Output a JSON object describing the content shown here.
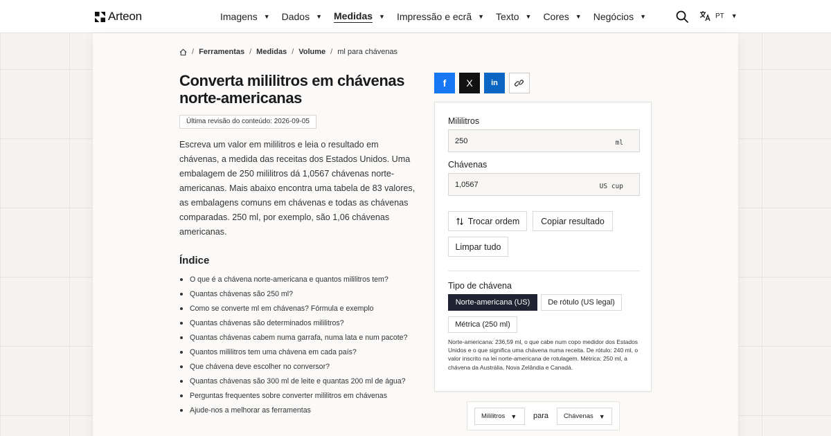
{
  "header": {
    "logo_text": "Arteon",
    "nav": [
      {
        "label": "Imagens",
        "active": false
      },
      {
        "label": "Dados",
        "active": false
      },
      {
        "label": "Medidas",
        "active": true
      },
      {
        "label": "Impressão e ecrã",
        "active": false
      },
      {
        "label": "Texto",
        "active": false
      },
      {
        "label": "Cores",
        "active": false
      },
      {
        "label": "Negócios",
        "active": false
      }
    ],
    "lang": "PT",
    "icons": {
      "search": "search-icon",
      "language": "translate-icon",
      "home": "home-icon"
    }
  },
  "breadcrumb": {
    "items": [
      "Ferramentas",
      "Medidas",
      "Volume"
    ],
    "current": "ml para chávenas"
  },
  "page": {
    "title": "Converta mililitros em chávenas norte-americanas",
    "revision": "Última revisão do conteúdo: 2026-09-05",
    "intro": "Escreva um valor em mililitros e leia o resultado em chávenas, a medida das receitas dos Estados Unidos. Uma embalagem de 250 mililitros dá 1,0567 chávenas norte-americanas. Mais abaixo encontra uma tabela de 83 valores, as embalagens comuns em chávenas e todas as chávenas comparadas. 250 ml, por exemplo, são 1,06 chávenas americanas."
  },
  "toc": {
    "title": "Índice",
    "items": [
      "O que é a chávena norte-americana e quantos mililitros tem?",
      "Quantas chávenas são 250 ml?",
      "Como se converte ml em chávenas? Fórmula e exemplo",
      "Quantas chávenas são determinados mililitros?",
      "Quantas chávenas cabem numa garrafa, numa lata e num pacote?",
      "Quantos mililitros tem uma chávena em cada país?",
      "Que chávena deve escolher no conversor?",
      "Quantas chávenas são 300 ml de leite e quantas 200 ml de água?",
      "Perguntas frequentes sobre converter mililitros em chávenas",
      "Ajude-nos a melhorar as ferramentas"
    ]
  },
  "share": {
    "facebook": "f",
    "x": "X",
    "linkedin": "in",
    "colors": {
      "facebook": "#1877f2",
      "x": "#111111",
      "linkedin": "#0a66c2"
    }
  },
  "converter": {
    "from_label": "Mililitros",
    "from_value": "250",
    "from_unit": "ml",
    "to_label": "Chávenas",
    "to_value": "1,0567",
    "to_unit": "US cup",
    "swap_label": "Trocar ordem",
    "copy_label": "Copiar resultado",
    "clear_label": "Limpar tudo",
    "cup_type_label": "Tipo de chávena",
    "cup_types": [
      "Norte-americana (US)",
      "De rótulo (US legal)",
      "Métrica (250 ml)"
    ],
    "selected_cup": "Norte-americana (US)",
    "note": "Norte-americana: 236,59 ml, o que cabe num copo medidor dos Estados Unidos e o que significa uma chávena numa receita. De rótulo: 240 ml, o valor inscrito na lei norte-americana de rotulagem. Métrica: 250 ml, a chávena da Austrália, Nova Zelândia e Canadá."
  },
  "unit_selector": {
    "from": "Mililitros",
    "connector": "para",
    "to": "Chávenas"
  }
}
